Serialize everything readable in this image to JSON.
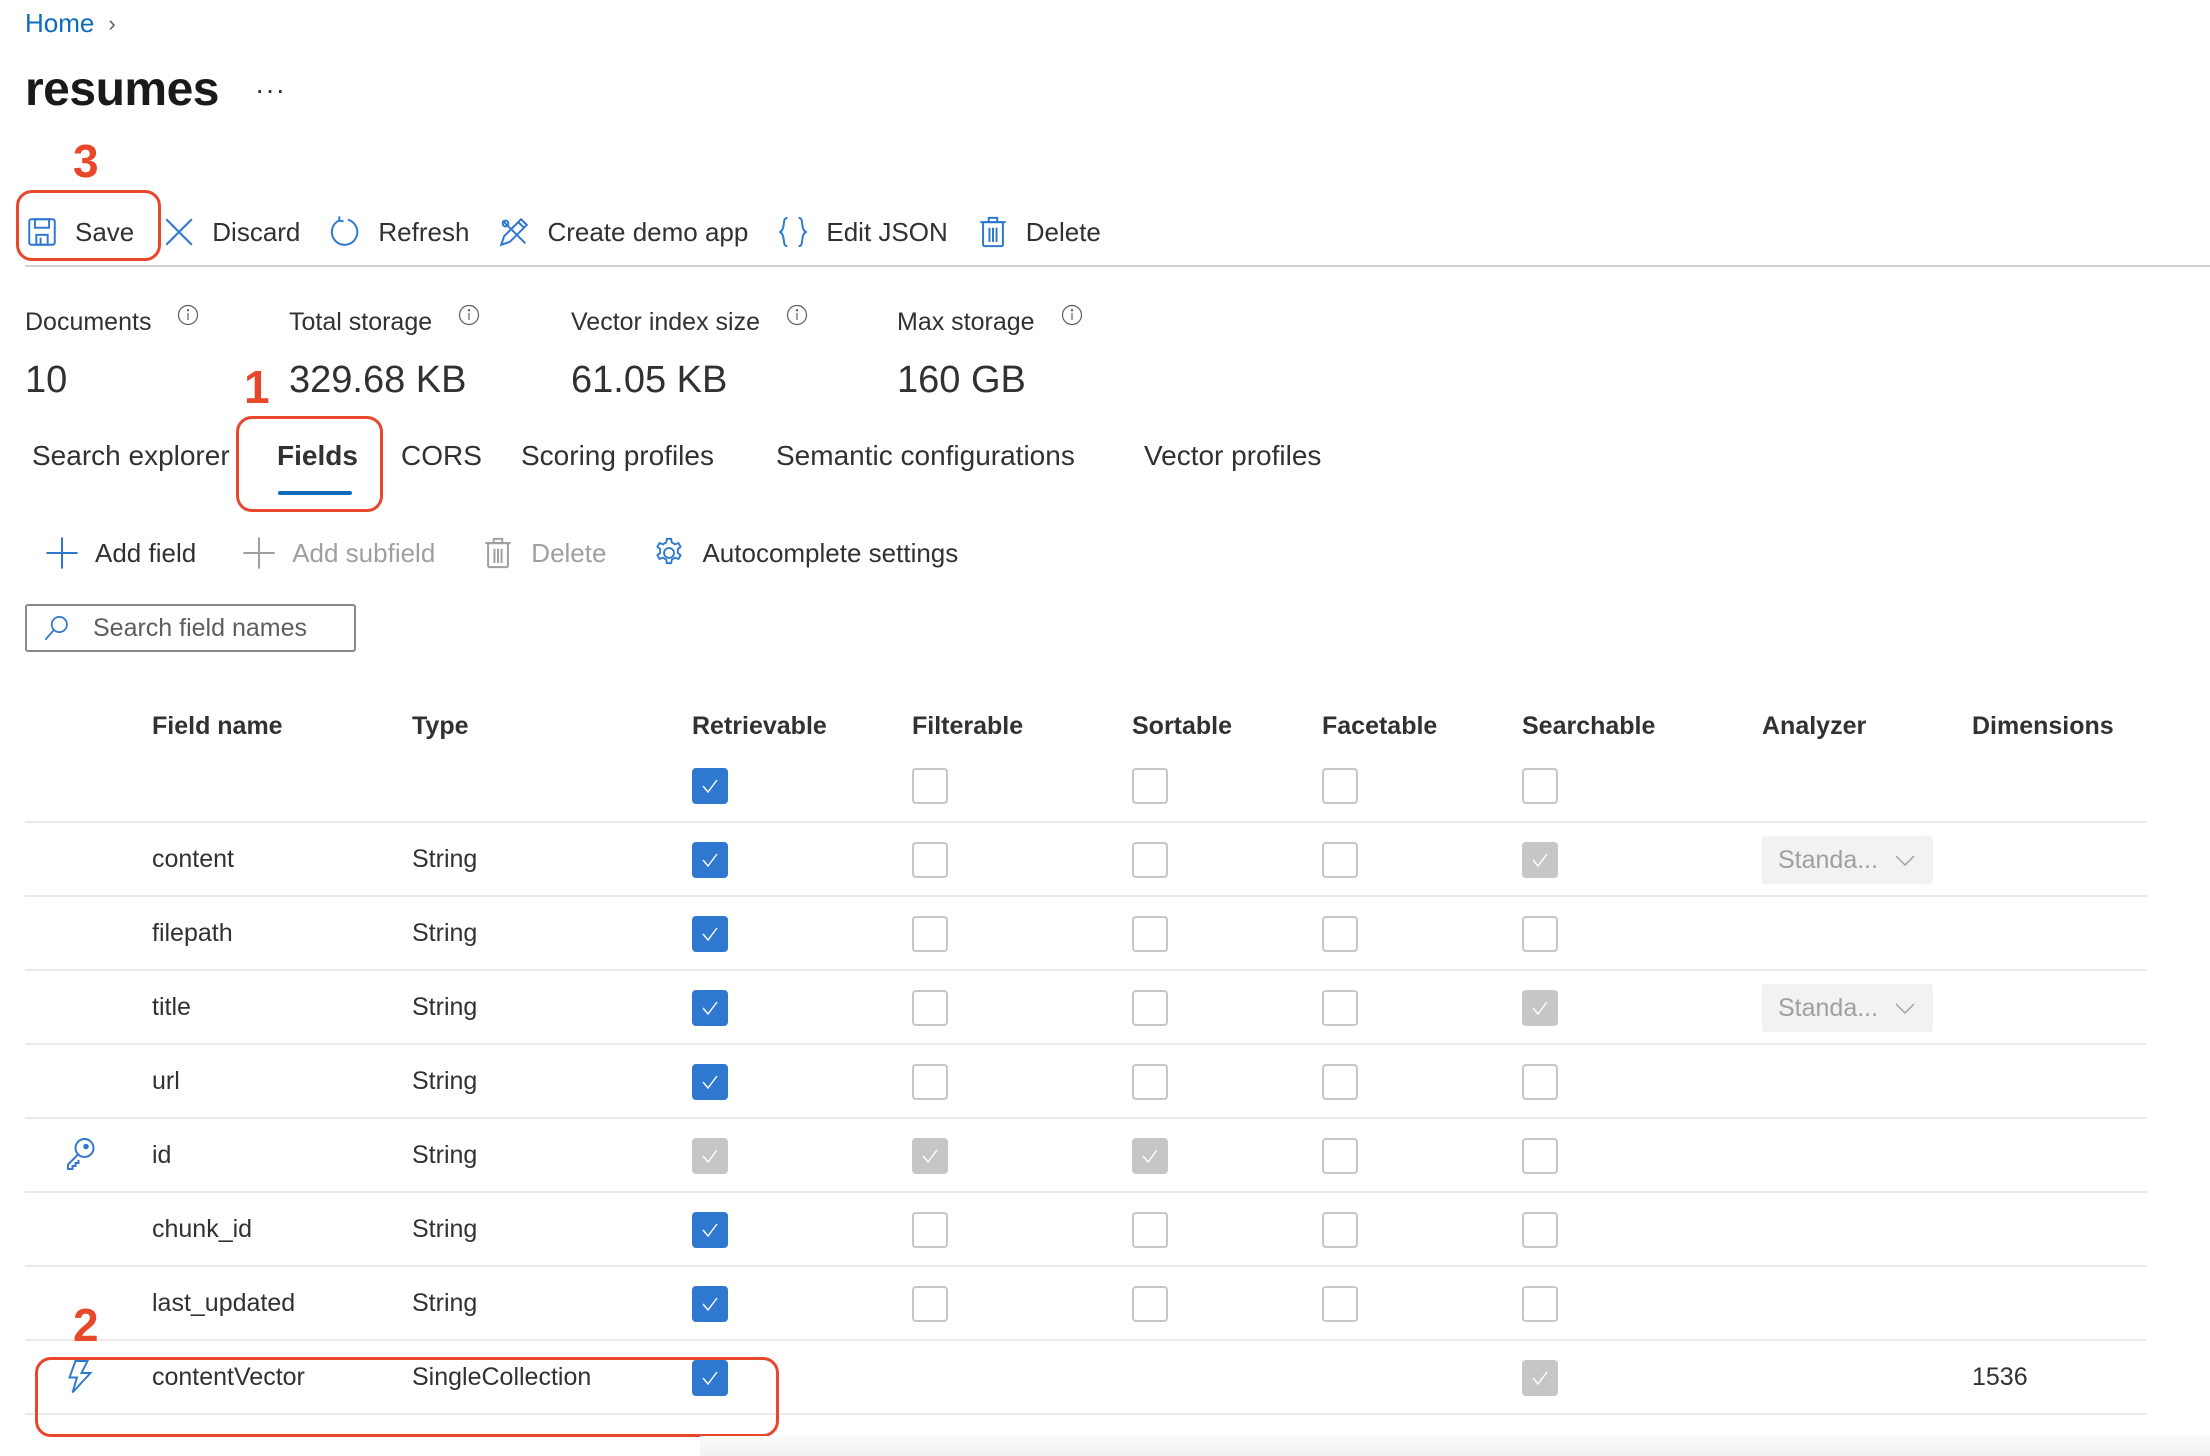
{
  "breadcrumb": {
    "home": "Home",
    "separator": "›"
  },
  "page": {
    "title": "resumes",
    "more": "···"
  },
  "toolbar": {
    "items": [
      {
        "label": "Save",
        "icon": "save-icon"
      },
      {
        "label": "Discard",
        "icon": "close-icon"
      },
      {
        "label": "Refresh",
        "icon": "refresh-icon"
      },
      {
        "label": "Create demo app",
        "icon": "demo-app-icon"
      },
      {
        "label": "Edit JSON",
        "icon": "braces-icon"
      },
      {
        "label": "Delete",
        "icon": "trash-icon"
      }
    ]
  },
  "stats": [
    {
      "label": "Documents",
      "value": "10"
    },
    {
      "label": "Total storage",
      "value": "329.68 KB"
    },
    {
      "label": "Vector index size",
      "value": "61.05 KB"
    },
    {
      "label": "Max storage",
      "value": "160 GB"
    }
  ],
  "tabs": [
    {
      "label": "Search explorer",
      "active": false
    },
    {
      "label": "Fields",
      "active": true
    },
    {
      "label": "CORS",
      "active": false
    },
    {
      "label": "Scoring profiles",
      "active": false
    },
    {
      "label": "Semantic configurations",
      "active": false
    },
    {
      "label": "Vector profiles",
      "active": false
    }
  ],
  "field_toolbar": {
    "add_field": "Add field",
    "add_subfield": "Add subfield",
    "delete": "Delete",
    "autocomplete": "Autocomplete settings"
  },
  "search": {
    "placeholder": "Search field names",
    "value": ""
  },
  "table": {
    "headers": [
      "Field name",
      "Type",
      "Retrievable",
      "Filterable",
      "Sortable",
      "Facetable",
      "Searchable",
      "Analyzer",
      "Dimensions"
    ],
    "select_all": {
      "retrievable": "checked",
      "filterable": "unchecked",
      "sortable": "unchecked",
      "facetable": "unchecked",
      "searchable": "unchecked"
    },
    "rows": [
      {
        "icon": "",
        "name": "content",
        "type": "String",
        "retrievable": "checked",
        "filterable": "unchecked",
        "sortable": "unchecked",
        "facetable": "unchecked",
        "searchable": "disabled-checked",
        "analyzer": "Standa...",
        "dimensions": ""
      },
      {
        "icon": "",
        "name": "filepath",
        "type": "String",
        "retrievable": "checked",
        "filterable": "unchecked",
        "sortable": "unchecked",
        "facetable": "unchecked",
        "searchable": "unchecked",
        "analyzer": "",
        "dimensions": ""
      },
      {
        "icon": "",
        "name": "title",
        "type": "String",
        "retrievable": "checked",
        "filterable": "unchecked",
        "sortable": "unchecked",
        "facetable": "unchecked",
        "searchable": "disabled-checked",
        "analyzer": "Standa...",
        "dimensions": ""
      },
      {
        "icon": "",
        "name": "url",
        "type": "String",
        "retrievable": "checked",
        "filterable": "unchecked",
        "sortable": "unchecked",
        "facetable": "unchecked",
        "searchable": "unchecked",
        "analyzer": "",
        "dimensions": ""
      },
      {
        "icon": "key-icon",
        "name": "id",
        "type": "String",
        "retrievable": "disabled-checked",
        "filterable": "disabled-checked",
        "sortable": "disabled-checked",
        "facetable": "unchecked",
        "searchable": "unchecked",
        "analyzer": "",
        "dimensions": ""
      },
      {
        "icon": "",
        "name": "chunk_id",
        "type": "String",
        "retrievable": "checked",
        "filterable": "unchecked",
        "sortable": "unchecked",
        "facetable": "unchecked",
        "searchable": "unchecked",
        "analyzer": "",
        "dimensions": ""
      },
      {
        "icon": "",
        "name": "last_updated",
        "type": "String",
        "retrievable": "checked",
        "filterable": "unchecked",
        "sortable": "unchecked",
        "facetable": "unchecked",
        "searchable": "unchecked",
        "analyzer": "",
        "dimensions": ""
      },
      {
        "icon": "vector-icon",
        "name": "contentVector",
        "type": "SingleCollection",
        "retrievable": "checked",
        "filterable": "",
        "sortable": "",
        "facetable": "",
        "searchable": "disabled-checked",
        "analyzer": "",
        "dimensions": "1536"
      }
    ]
  },
  "annotations": [
    {
      "number": "1",
      "target": "Fields tab"
    },
    {
      "number": "2",
      "target": "contentVector row"
    },
    {
      "number": "3",
      "target": "Save button"
    }
  ],
  "colors": {
    "accent": "#0f6cbd",
    "checkbox": "#2f78d0",
    "annotation": "#e8472b",
    "disabled": "#c8c6c4"
  }
}
